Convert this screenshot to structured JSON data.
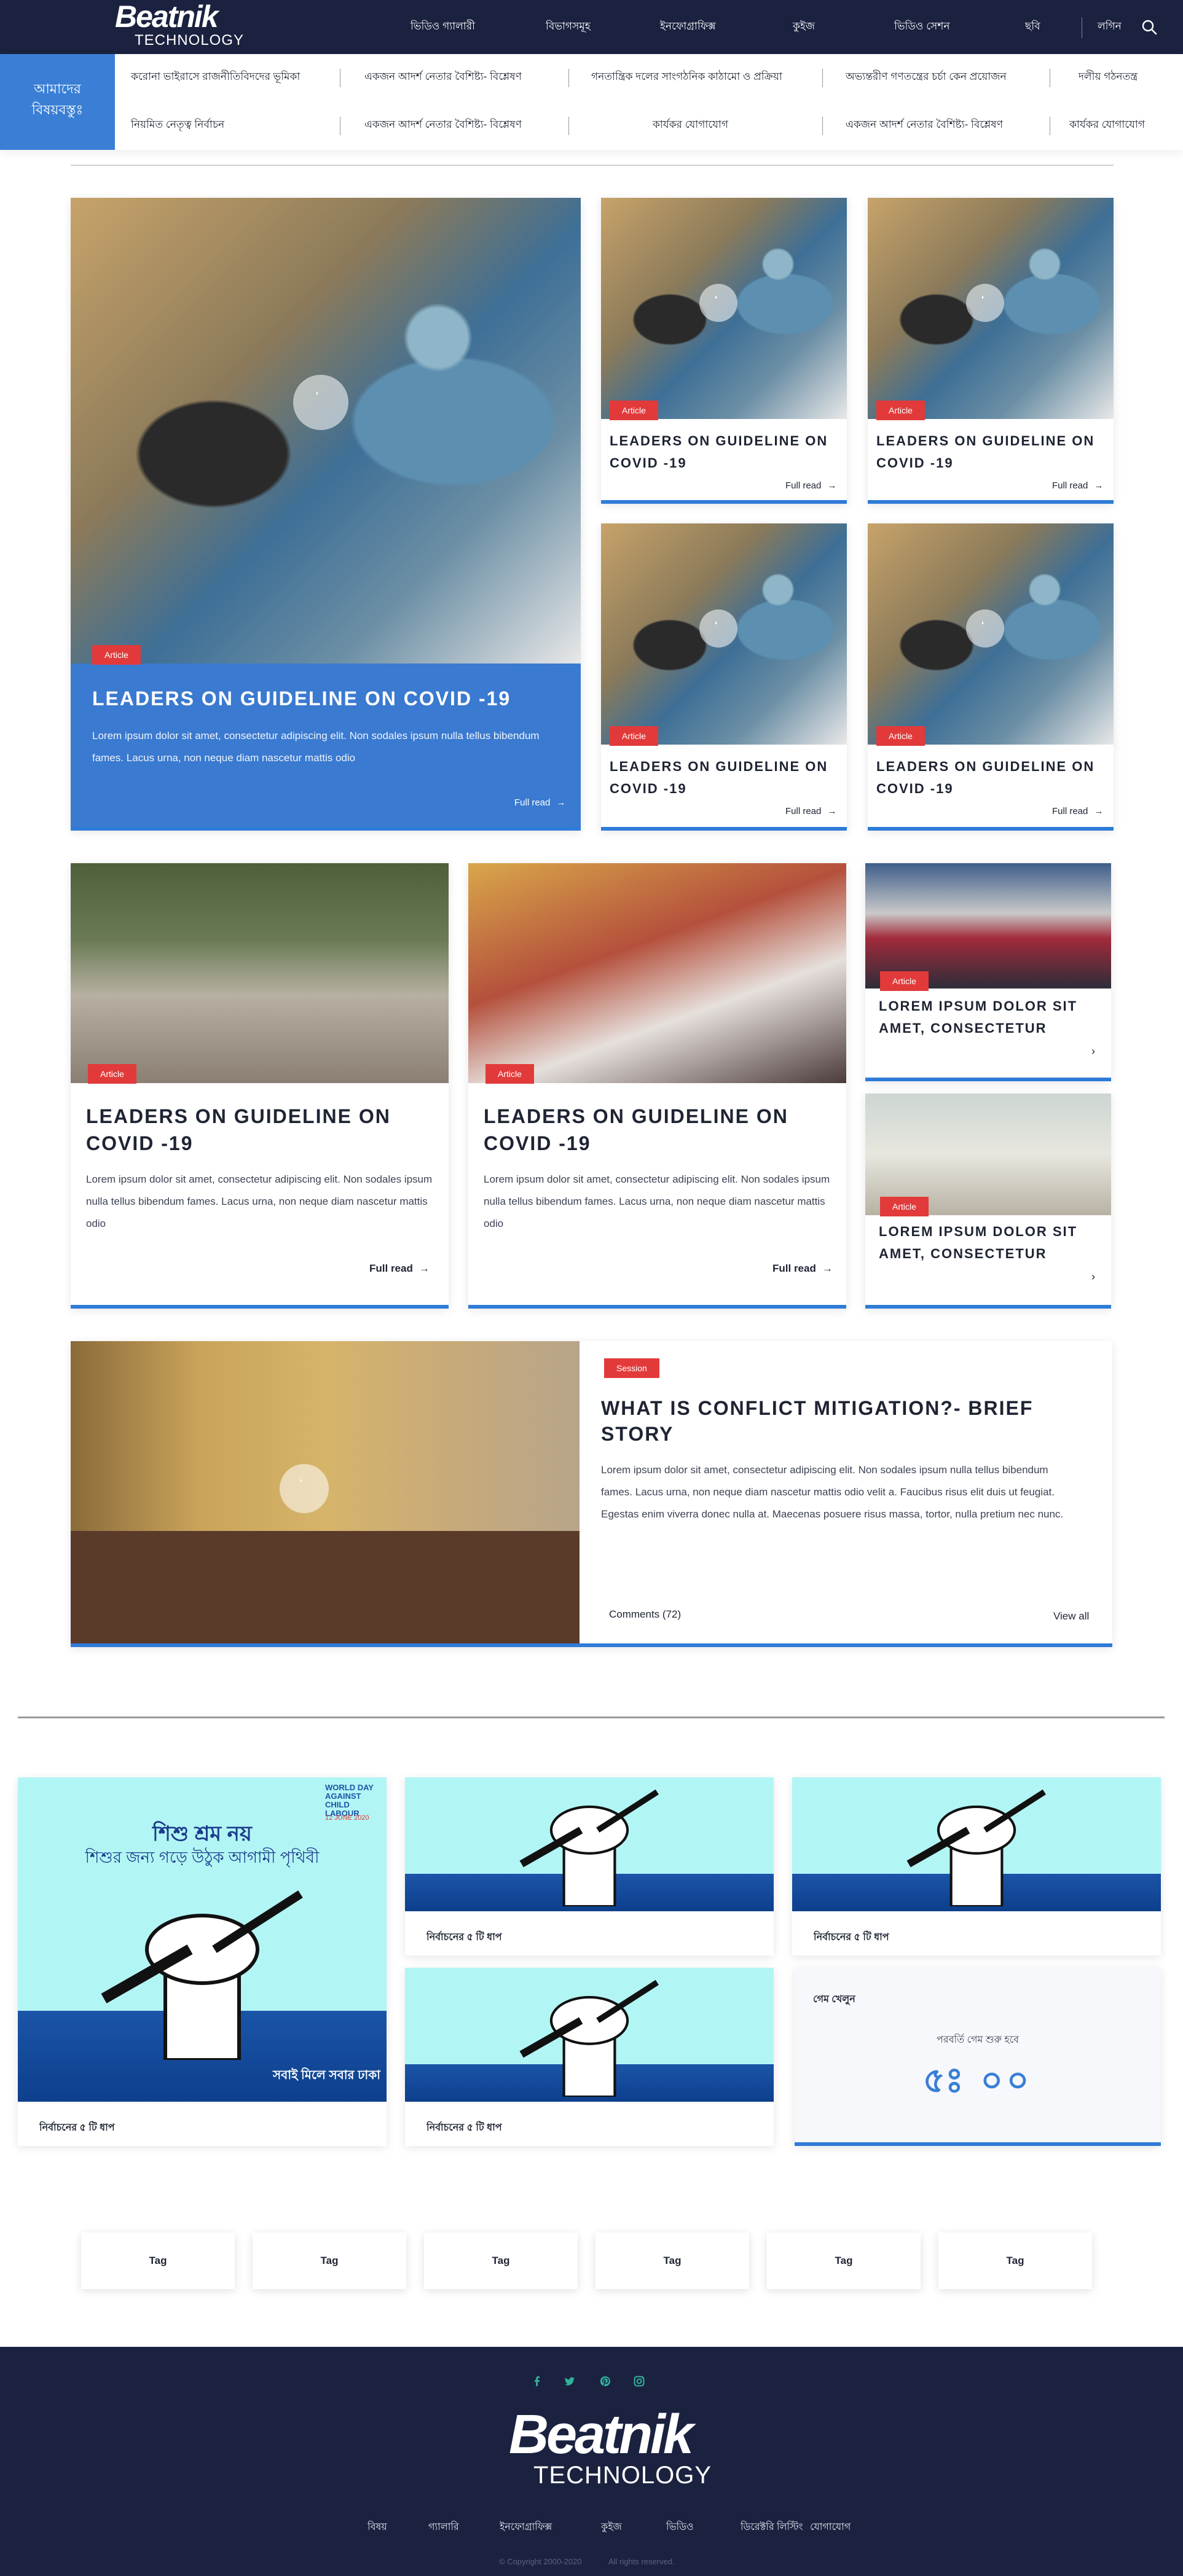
{
  "header": {
    "logo_primary": "Beatnik",
    "logo_secondary": "TECHNOLOGY",
    "nav": [
      "ভিডিও গ্যালারী",
      "বিভাগসমূহ",
      "ইনফোগ্রাফিক্স",
      "কুইজ",
      "ভিডিও সেশন",
      "ছবি"
    ],
    "login": "লগিন"
  },
  "topics": {
    "label_line1": "আমাদের",
    "label_line2": "বিষয়বস্তুঃ",
    "row1": [
      "করোনা ভাইরাসে রাজনীতিবিদদের ভূমিকা",
      "একজন আদর্শ নেতার বৈশিষ্ট্য- বিশ্লেষণ",
      "গনতান্ত্রিক দলের সাংগঠনিক কাঠামো ও প্রক্রিয়া",
      "অভ্যন্তরীণ গণতন্ত্রের চর্চা কেন প্রয়োজন",
      "দলীয় গঠনতন্ত্র"
    ],
    "row2": [
      "নিয়মিত নেতৃত্ব নির্বাচন",
      "একজন আদর্শ নেতার বৈশিষ্ট্য- বিশ্লেষণ",
      "কার্যকর যোগাযোগ",
      "একজন আদর্শ নেতার বৈশিষ্ট্য- বিশ্লেষণ",
      "কার্যকর যোগাযোগ"
    ]
  },
  "featured": {
    "badge": "Article",
    "title": "LEADERS ON GUIDELINE ON COVID -19",
    "excerpt": "Lorem ipsum dolor sit amet, consectetur adipiscing elit. Non sodales ipsum nulla tellus bibendum fames. Lacus urna, non neque diam nascetur mattis odio",
    "read_more": "Full read"
  },
  "small_cards": [
    {
      "badge": "Article",
      "title": "LEADERS ON GUIDELINE ON COVID -19",
      "read_more": "Full read"
    },
    {
      "badge": "Article",
      "title": "LEADERS ON GUIDELINE ON COVID -19",
      "read_more": "Full read"
    },
    {
      "badge": "Article",
      "title": "LEADERS ON GUIDELINE ON COVID -19",
      "read_more": "Full read"
    },
    {
      "badge": "Article",
      "title": "LEADERS ON GUIDELINE ON COVID -19",
      "read_more": "Full read"
    }
  ],
  "mid_cards": [
    {
      "badge": "Article",
      "title": "LEADERS ON GUIDELINE ON COVID -19",
      "excerpt": "Lorem ipsum dolor sit amet, consectetur adipiscing elit. Non sodales ipsum nulla tellus bibendum fames. Lacus urna, non neque diam nascetur mattis odio",
      "read_more": "Full read"
    },
    {
      "badge": "Article",
      "title": "LEADERS ON GUIDELINE ON COVID -19",
      "excerpt": "Lorem ipsum dolor sit amet, consectetur adipiscing elit. Non sodales ipsum nulla tellus bibendum fames. Lacus urna, non neque diam nascetur mattis odio",
      "read_more": "Full read"
    }
  ],
  "side_cards": [
    {
      "badge": "Article",
      "title": "LOREM IPSUM DOLOR SIT AMET, CONSECTETUR"
    },
    {
      "badge": "Article",
      "title": "LOREM IPSUM DOLOR SIT AMET, CONSECTETUR"
    }
  ],
  "session": {
    "badge": "Session",
    "title": "WHAT IS CONFLICT MITIGATION?- BRIEF STORY",
    "excerpt": "Lorem ipsum dolor sit amet, consectetur adipiscing elit. Non sodales ipsum nulla tellus bibendum fames. Lacus urna, non neque diam nascetur mattis odio velit a. Faucibus risus elit duis ut feugiat. Egestas enim viverra donec nulla at. Maecenas posuere risus massa, tortor, nulla pretium nec nunc.",
    "comments": "Comments (72)",
    "view_all": "View all"
  },
  "infographics": {
    "poster_header": "WORLD DAY AGAINST CHILD LABOUR",
    "poster_date": "12 JUNE 2020",
    "poster_slogan1": "শিশু শ্রম নয়",
    "poster_slogan2": "শিশুর জন্য গড়ে উঠুক আগামী পৃথিবী",
    "poster_footer": "সবাই মিলে সবার ঢাকা",
    "caption": "নির্বাচনের ৫ টি ধাপ"
  },
  "quiz": {
    "title": "গেম খেলুন",
    "subtitle": "পরবর্তি গেম শুরু হবে",
    "timer": "৫ঃ ০০"
  },
  "tags": [
    "Tag",
    "Tag",
    "Tag",
    "Tag",
    "Tag",
    "Tag"
  ],
  "footer": {
    "logo_primary": "Beatnik",
    "logo_secondary": "TECHNOLOGY",
    "links": [
      "বিষয়",
      "গ্যালারি",
      "ইনফোগ্রাফিক্স",
      "কুইজ",
      "ভিডিও",
      "ডিরেক্টরি লিস্টিং",
      "যোগাযোগ"
    ],
    "copyright": "© Copyright 2000-2020",
    "rights": "All rights reserved."
  },
  "colors": {
    "navy": "#1b2240",
    "accent_blue": "#3a7fd5",
    "badge_red": "#e23a3a",
    "social_green": "#2fb39a"
  }
}
